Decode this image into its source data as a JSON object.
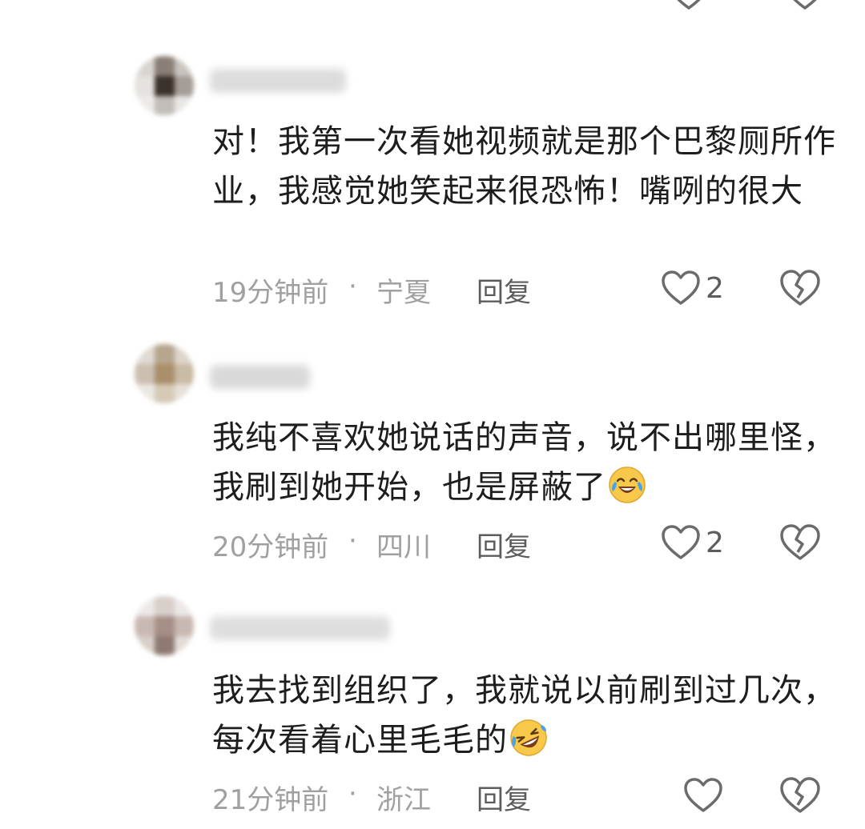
{
  "comments": [
    {
      "text": "对！我第一次看她视频就是那个巴黎厕所作业，我感觉她笑起来很恐怖！嘴咧的很大",
      "emoji": "",
      "time": "19分钟前",
      "separator": "·",
      "region": "宁夏",
      "reply_label": "回复",
      "likes": "2"
    },
    {
      "text": "我纯不喜欢她说话的声音，说不出哪里怪，我刷到她开始，也是屏蔽了",
      "emoji": "crying-laughing-emoji",
      "time": "20分钟前",
      "separator": "·",
      "region": "四川",
      "reply_label": "回复",
      "likes": "2"
    },
    {
      "text": "我去找到组织了，我就说以前刷到过几次，每次看着心里毛毛的",
      "emoji": "rolling-laughing-emoji",
      "time": "21分钟前",
      "separator": "·",
      "region": "浙江",
      "reply_label": "回复",
      "likes": ""
    }
  ],
  "colors": {
    "meta_gray": "#a0a0a0",
    "text_dark": "#1d1d1d",
    "icon_gray": "#6b6b6b",
    "emoji_yellow": "#f7c84a",
    "tear_blue": "#4aa3e8"
  },
  "icons": {
    "like": "heart-outline-icon",
    "dislike": "broken-heart-icon"
  }
}
